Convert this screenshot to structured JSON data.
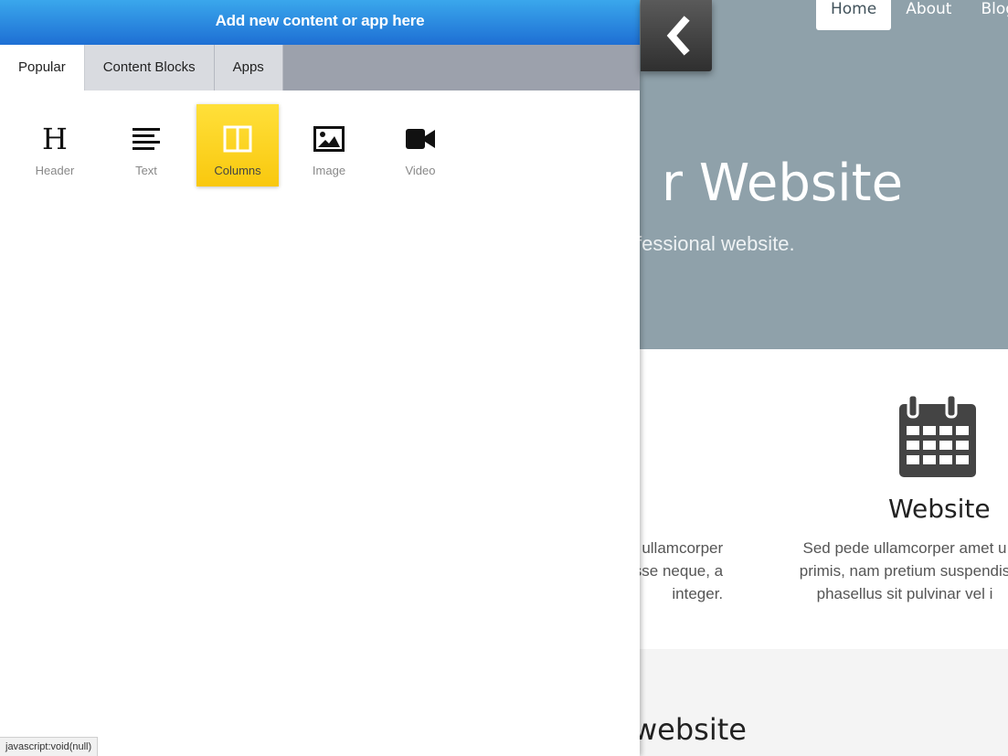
{
  "panel": {
    "header": "Add new content or app here",
    "tabs": [
      {
        "label": "Popular"
      },
      {
        "label": "Content Blocks"
      },
      {
        "label": "Apps"
      }
    ],
    "tiles": [
      {
        "label": "Header",
        "icon": "header-icon"
      },
      {
        "label": "Text",
        "icon": "text-icon"
      },
      {
        "label": "Columns",
        "icon": "columns-icon"
      },
      {
        "label": "Image",
        "icon": "image-icon"
      },
      {
        "label": "Video",
        "icon": "video-icon"
      }
    ]
  },
  "site": {
    "nav": [
      "Home",
      "About",
      "Blog"
    ],
    "hero_title": "r Website",
    "hero_subtitle": "fessional website.",
    "feature_title": "Website",
    "feature_left_text": "ullamcorper\nisse neque, a\ninteger.",
    "feature_right_text": "Sed pede ullamcorper amet u\nprimis, nam pretium suspendis\nphasellus sit pulvinar vel i",
    "bottom_title": "website"
  },
  "status_bar": "javascript:void(null)",
  "colors": {
    "header_accent": "#1e6fd4",
    "selected_tile": "#f9c80e",
    "hero_bg": "#8fa1aa"
  }
}
